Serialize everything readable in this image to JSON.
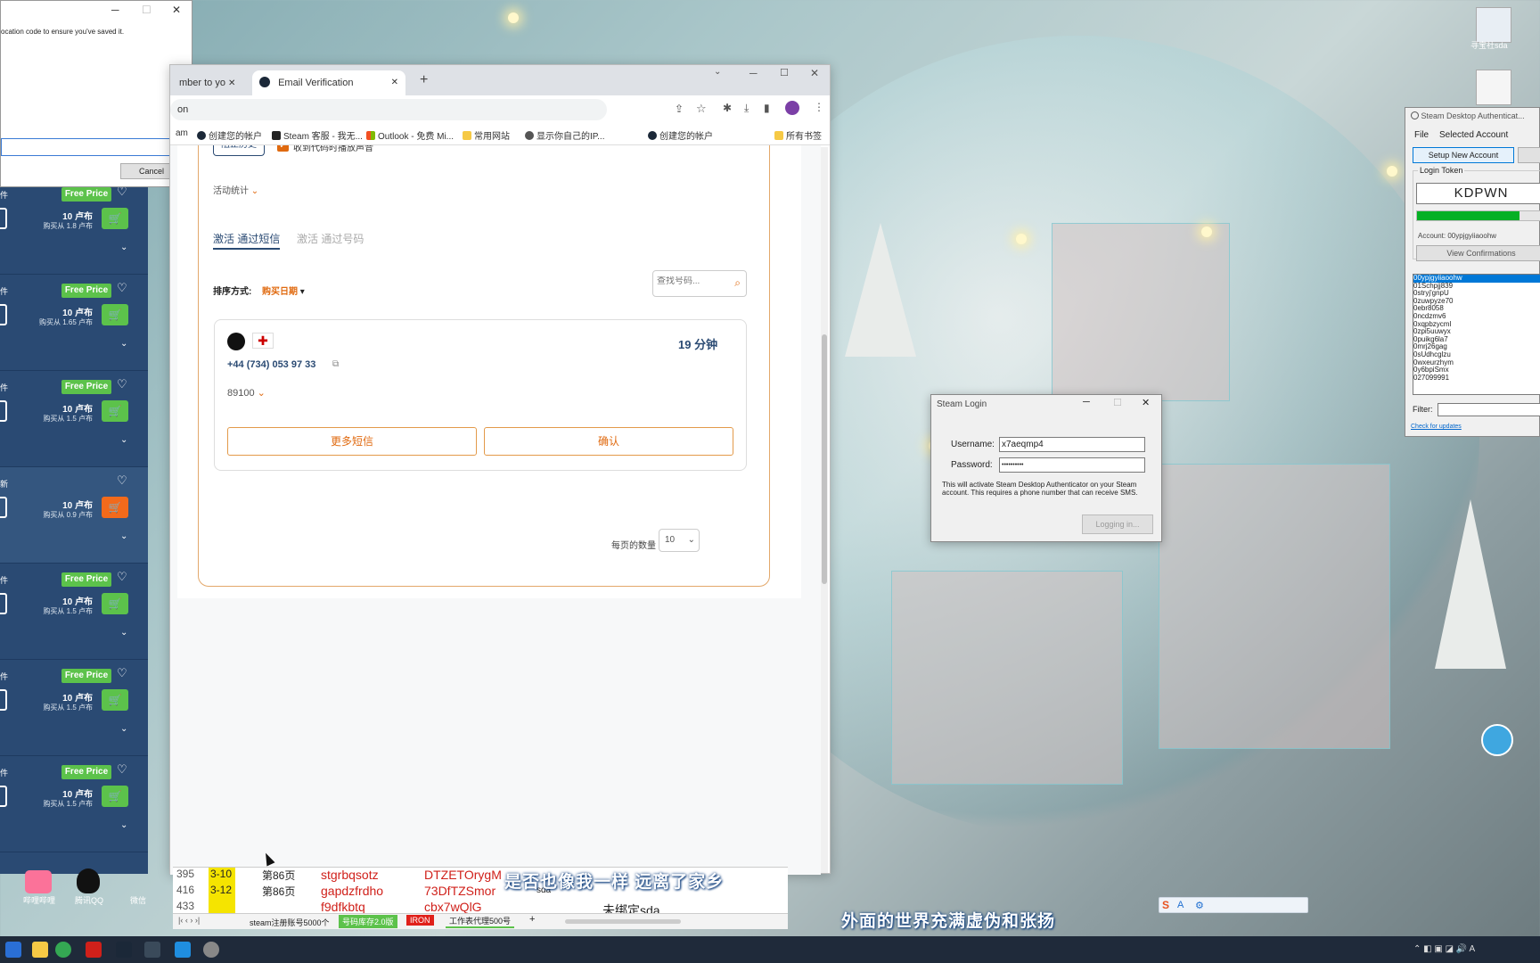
{
  "top_dialog": {
    "text": "ocation code to ensure you've saved it.",
    "cancel": "Cancel"
  },
  "left_panel": {
    "badge": "Free Price",
    "items": [
      {
        "price": "10 卢布",
        "sub": "购买从 1.8 卢布",
        "label": "件"
      },
      {
        "price": "10 卢布",
        "sub": "购买从 1.65 卢布",
        "label": "件"
      },
      {
        "price": "10 卢布",
        "sub": "购买从 1.5 卢布",
        "label": "件"
      },
      {
        "price": "10 卢布",
        "sub": "购买从 0.9 卢布",
        "label": "新"
      },
      {
        "price": "10 卢布",
        "sub": "购买从 1.5 卢布",
        "label": "件"
      },
      {
        "price": "10 卢布",
        "sub": "购买从 1.5 卢布",
        "label": "件"
      },
      {
        "price": "10 卢布",
        "sub": "购买从 1.5 卢布",
        "label": "件"
      }
    ]
  },
  "browser": {
    "tabs": [
      {
        "label": "mber to yo"
      },
      {
        "label": "Email Verification"
      }
    ],
    "address": "on",
    "bookmarks": [
      "am",
      "创建您的帐户",
      "Steam 客服 - 我无...",
      "Outlook - 免费 Mi...",
      "常用网站",
      "显示你自己的IP...",
      "创建您的帐户",
      "所有书签"
    ],
    "page": {
      "history_btn": "阻止历史",
      "checkbox_label": "收到代码时播放声音",
      "stats": "活动统计",
      "tab_sms": "激活 通过短信",
      "tab_number": "激活 通过号码",
      "sort_label": "排序方式:",
      "sort_value": "购买日期",
      "search_placeholder": "查找号码...",
      "flag": "🏴",
      "time": "19 分钟",
      "phone": "+44 (734) 053 97 33",
      "code": "89100",
      "more_sms": "更多短信",
      "confirm": "确认",
      "per_page_label": "每页的数量",
      "per_page_value": "10"
    }
  },
  "steam_login": {
    "title": "Steam Login",
    "username_label": "Username:",
    "username_value": "x7aeqmp4",
    "password_label": "Password:",
    "password_value": "••••••••••",
    "note": "This will activate Steam Desktop Authenticator on your Steam account. This requires a phone number that can receive SMS.",
    "button": "Logging in..."
  },
  "sda": {
    "title": "Steam Desktop Authenticat...",
    "menu_file": "File",
    "menu_selected": "Selected Account",
    "setup_btn": "Setup New Account",
    "login_token_label": "Login Token",
    "token": "KDPWN",
    "token_progress": 0.8,
    "account_label": "Account: 00ypjgyiiaoohw",
    "view_confirmations": "View Confirmations",
    "accounts": [
      "00ypjgyiiaoohw",
      "01Schpjj839",
      "0stryj'gnpU",
      "0zuwpyze70",
      "0ebr8058",
      "0ncdzmv6",
      "0xqpbzycml",
      "0zpi5uuwyx",
      "0puikg6la7",
      "0mrj26gag",
      "0sUdhcglzu",
      "0wxeurzhym",
      "0y6bpiSmx",
      "027099991"
    ],
    "filter_label": "Filter:",
    "check_updates": "Check for updates"
  },
  "spreadsheet": {
    "rows": [
      {
        "num": "395",
        "date": "3-10",
        "col": "第86页",
        "a": "stgrbqsotz",
        "b": "DTZETOrygM"
      },
      {
        "num": "416",
        "date": "3-12",
        "col": "第86页",
        "a": "gapdzfrdho",
        "b": "73DfTZSmor",
        "c": "sda"
      },
      {
        "num": "433",
        "date": "",
        "col": "",
        "a": "f9dfkbtq",
        "b": "cbx7wQlG",
        "c": "未绑定sda"
      }
    ],
    "sheet_tabs": [
      "steam注册账号5000个",
      "号码库存2.0版",
      "IRON",
      "工作表代理500号"
    ]
  },
  "subtitles": {
    "line1": "是否也像我一样  远离了家乡",
    "line2": "外面的世界充满虚伪和张扬"
  },
  "desktop": {
    "icon1_label": "寻宝社sda",
    "taskbar_apps": [
      "哔哩哔哩",
      "腾讯QQ",
      "微信"
    ]
  },
  "colors": {
    "accent_orange": "#e06a10",
    "free_price_green": "#5cc24b",
    "panel_blue": "#2a4a73"
  }
}
